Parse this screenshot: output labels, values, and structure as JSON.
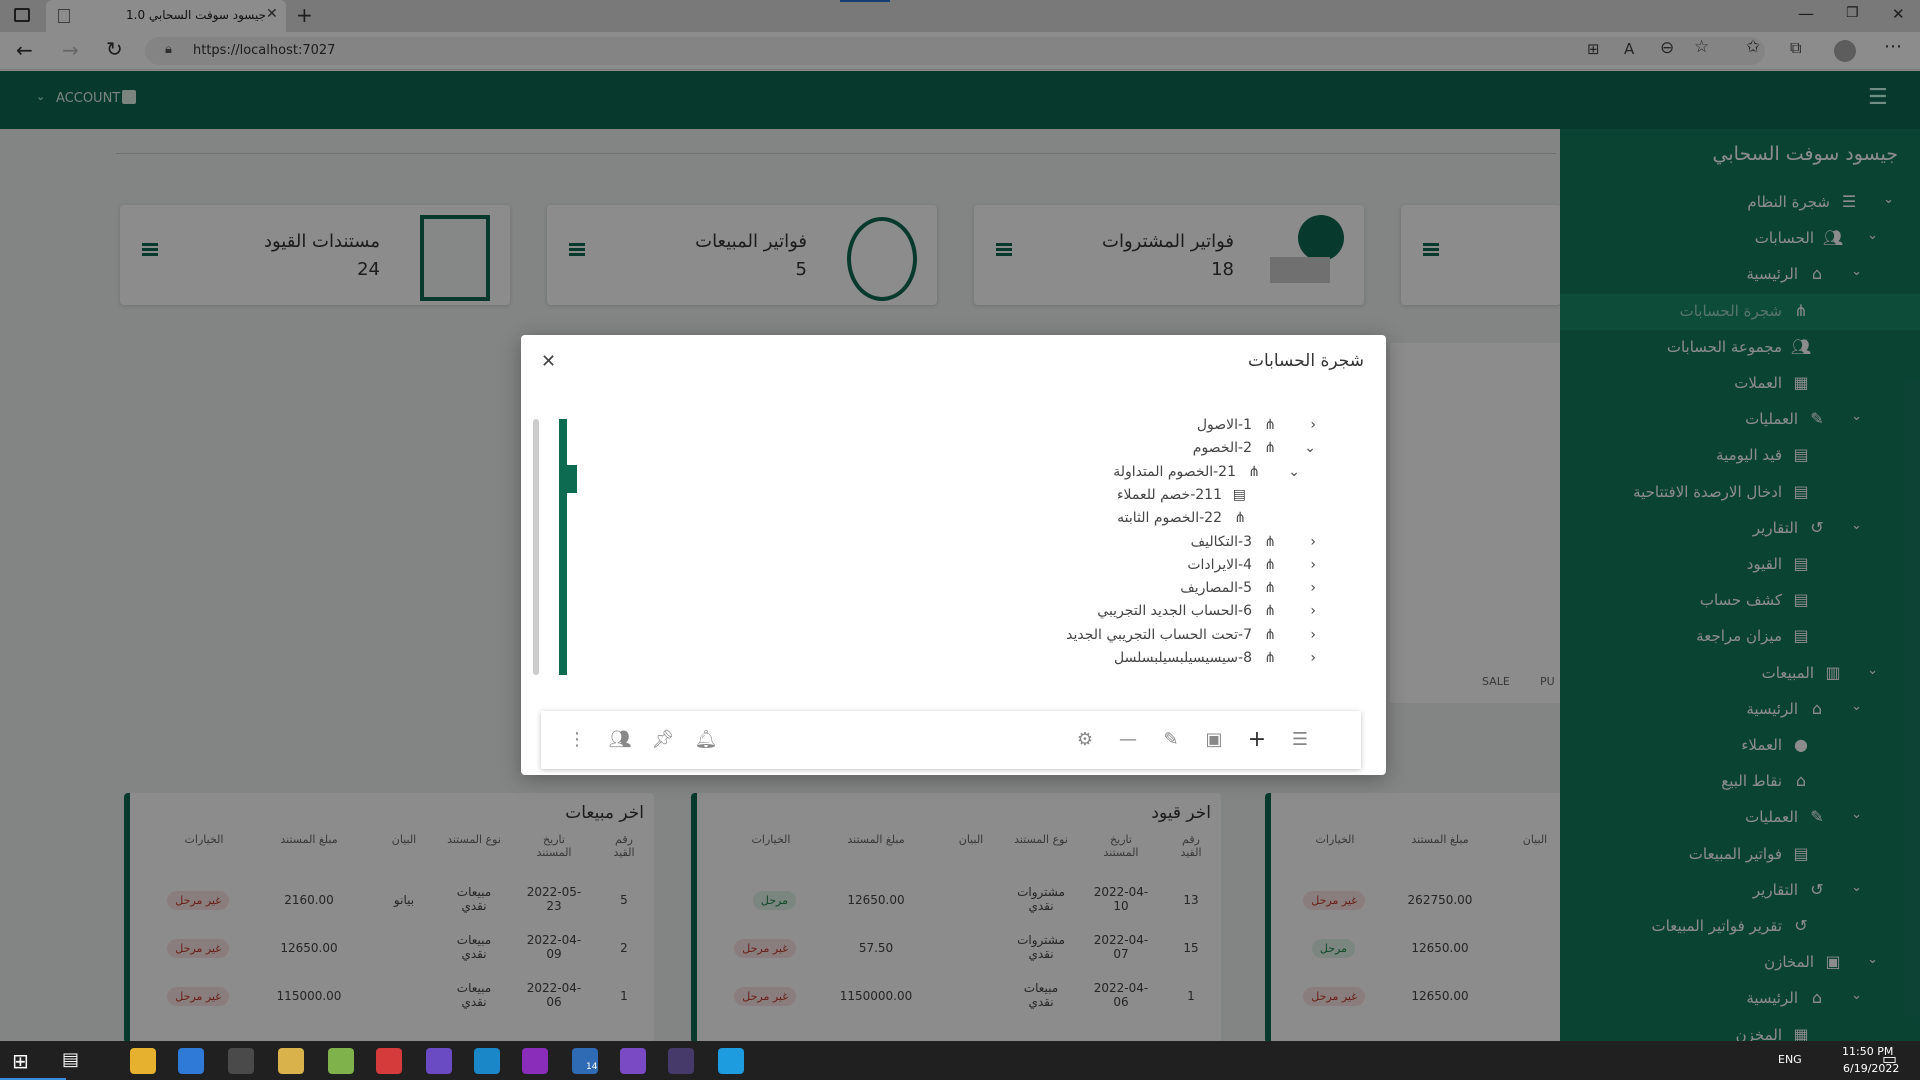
{
  "browser": {
    "tab_title": "جيسود سوفت السحابي 1.0",
    "url": "https://localhost:7027"
  },
  "topbar": {
    "account_label": "ACCOUNT"
  },
  "sidebar": {
    "brand": "جيسود سوفت السحابي",
    "items": [
      {
        "label": "شجرة النظام",
        "icon": "bars-icon",
        "chev": "down",
        "level": 0
      },
      {
        "label": "الحسابات",
        "icon": "users-icon",
        "chev": "down",
        "level": 1
      },
      {
        "label": "الرئيسية",
        "icon": "home-icon",
        "chev": "down",
        "level": 2
      },
      {
        "label": "شجرة الحسابات",
        "icon": "tree-icon",
        "chev": "",
        "level": 3,
        "active": true
      },
      {
        "label": "مجموعة الحسابات",
        "icon": "group-icon",
        "chev": "",
        "level": 3
      },
      {
        "label": "العملات",
        "icon": "currency-icon",
        "chev": "",
        "level": 3
      },
      {
        "label": "العمليات",
        "icon": "pencil-icon",
        "chev": "down",
        "level": 2
      },
      {
        "label": "قيد اليومية",
        "icon": "file-icon",
        "chev": "",
        "level": 3
      },
      {
        "label": "ادخال الارصدة الافتتاحية",
        "icon": "file-icon",
        "chev": "",
        "level": 3
      },
      {
        "label": "التقارير",
        "icon": "history-icon",
        "chev": "down",
        "level": 2
      },
      {
        "label": "القيود",
        "icon": "doc-icon",
        "chev": "",
        "level": 3
      },
      {
        "label": "كشف حساب",
        "icon": "doc-icon",
        "chev": "",
        "level": 3
      },
      {
        "label": "ميزان مراجعة",
        "icon": "doc-icon",
        "chev": "",
        "level": 3
      },
      {
        "label": "المبيعات",
        "icon": "chart-icon",
        "chev": "down",
        "level": 1
      },
      {
        "label": "الرئيسية",
        "icon": "home-icon",
        "chev": "down",
        "level": 2
      },
      {
        "label": "العملاء",
        "icon": "user-icon",
        "chev": "",
        "level": 3
      },
      {
        "label": "نقاط البيع",
        "icon": "home-icon",
        "chev": "",
        "level": 3
      },
      {
        "label": "العمليات",
        "icon": "pencil-icon",
        "chev": "down",
        "level": 2
      },
      {
        "label": "فواتير المبيعات",
        "icon": "file-icon",
        "chev": "",
        "level": 3
      },
      {
        "label": "التقارير",
        "icon": "history-icon",
        "chev": "down",
        "level": 2
      },
      {
        "label": "تقرير فواتير المبيعات",
        "icon": "history-icon",
        "chev": "",
        "level": 3
      },
      {
        "label": "المخازن",
        "icon": "store-icon",
        "chev": "down",
        "level": 1
      },
      {
        "label": "الرئيسية",
        "icon": "home-icon",
        "chev": "down",
        "level": 2
      },
      {
        "label": "المخزن",
        "icon": "calendar-icon",
        "chev": "",
        "level": 3
      }
    ]
  },
  "cards": [
    {
      "title": "مستندات القيود",
      "value": "24"
    },
    {
      "title": "فواتير المبيعات",
      "value": "5"
    },
    {
      "title": "فواتير المشتروات",
      "value": "18"
    }
  ],
  "chart_legend": [
    "SALE",
    "PU"
  ],
  "panels": {
    "sales": {
      "title": "اخر مبيعات",
      "headers": [
        "رقم القيد",
        "تاريخ المستند",
        "نوع المستند",
        "البيان",
        "مبلغ المستند",
        "الخيارات"
      ],
      "rows": [
        [
          "5",
          "2022-05-23",
          "مبيعات نقدي",
          "بيانو",
          "2160.00",
          "غير مرحل"
        ],
        [
          "2",
          "2022-04-09",
          "مبيعات نقدي",
          "",
          "12650.00",
          "غير مرحل"
        ],
        [
          "1",
          "2022-04-06",
          "مبيعات نقدي",
          "",
          "115000.00",
          "غير مرحل"
        ]
      ]
    },
    "entries": {
      "title": "اخر قيود",
      "headers": [
        "رقم القيد",
        "تاريخ المستند",
        "نوع المستند",
        "البيان",
        "مبلغ المستند",
        "الخيارات"
      ],
      "rows": [
        [
          "13",
          "2022-04-10",
          "مشتروات نقدي",
          "",
          "12650.00",
          "مرحل"
        ],
        [
          "15",
          "2022-04-07",
          "مشتروات نقدي",
          "",
          "57.50",
          "غير مرحل"
        ],
        [
          "1",
          "2022-04-06",
          "مبيعات نقدي",
          "",
          "1150000.00",
          "غير مرحل"
        ]
      ]
    },
    "third": {
      "headers": [
        "البيان",
        "مبلغ المستند",
        "الخيارات"
      ],
      "rows": [
        [
          "",
          "262750.00",
          "غير مرحل"
        ],
        [
          "",
          "12650.00",
          "مرحل"
        ],
        [
          "",
          "12650.00",
          "غير مرحل"
        ]
      ]
    }
  },
  "modal": {
    "title": "شجرة الحسابات",
    "tree": [
      {
        "label": "1-الاصول",
        "chev": "left"
      },
      {
        "label": "2-الخصوم",
        "chev": "down"
      },
      {
        "label": "21-الخصوم المتداولة",
        "chev": "down"
      },
      {
        "label": "211-خصم للعملاء",
        "chev": ""
      },
      {
        "label": "22-الخصوم الثابته",
        "chev": ""
      },
      {
        "label": "3-التكاليف",
        "chev": "left"
      },
      {
        "label": "4-الايرادات",
        "chev": "left"
      },
      {
        "label": "5-المصاريف",
        "chev": "left"
      },
      {
        "label": "6-الحساب الجديد التجريبي",
        "chev": "left"
      },
      {
        "label": "7-تحت الحساب التجريبي الجديد",
        "chev": "left"
      },
      {
        "label": "8-سيسيسيلبسيلبسلسل",
        "chev": "left"
      }
    ]
  },
  "taskbar": {
    "time": "11:50 PM",
    "date": "6/19/2022",
    "lang": "ENG",
    "badge": "14"
  }
}
